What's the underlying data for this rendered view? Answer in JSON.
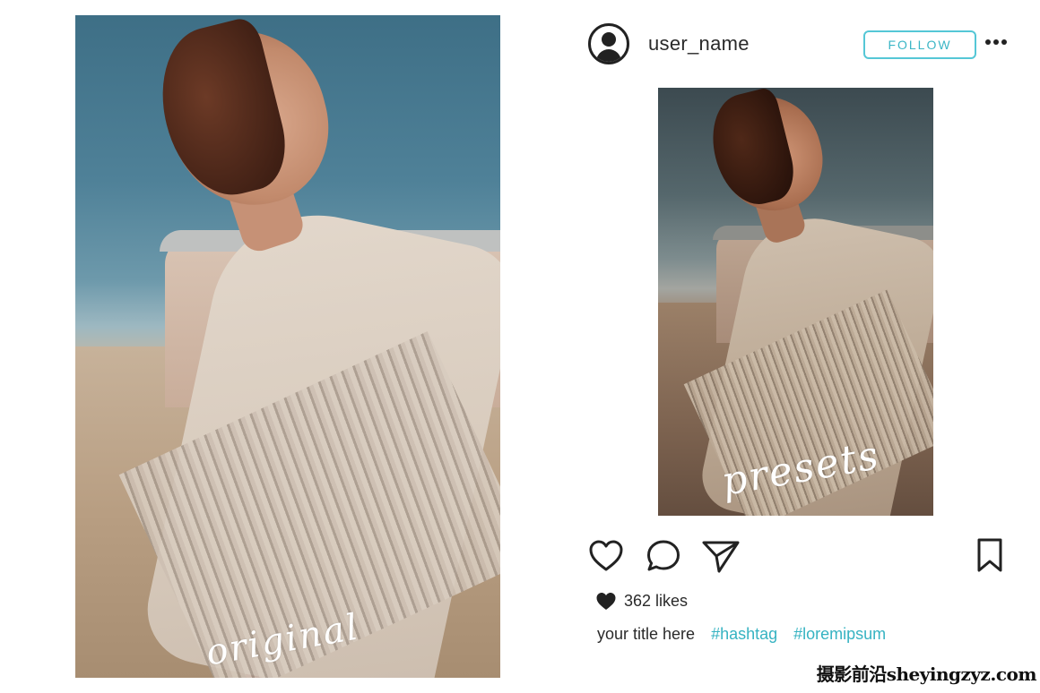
{
  "left_photo": {
    "caption": "original"
  },
  "post": {
    "username": "user_name",
    "follow_label": "FOLLOW",
    "photo_caption": "presets",
    "likes": "362 likes",
    "title": "your title here",
    "hashtags": [
      "#hashtag",
      "#loremipsum"
    ]
  },
  "icons": {
    "avatar": "user-avatar-icon",
    "more": "more-options-icon",
    "like": "heart-icon",
    "comment": "comment-icon",
    "share": "send-icon",
    "save": "bookmark-icon",
    "likes_heart": "filled-heart-icon"
  },
  "colors": {
    "accent": "#36b3c2",
    "follow_border": "#55c7d6",
    "text": "#2a2a2a"
  },
  "watermark": "摄影前沿sheyingzyz.com"
}
